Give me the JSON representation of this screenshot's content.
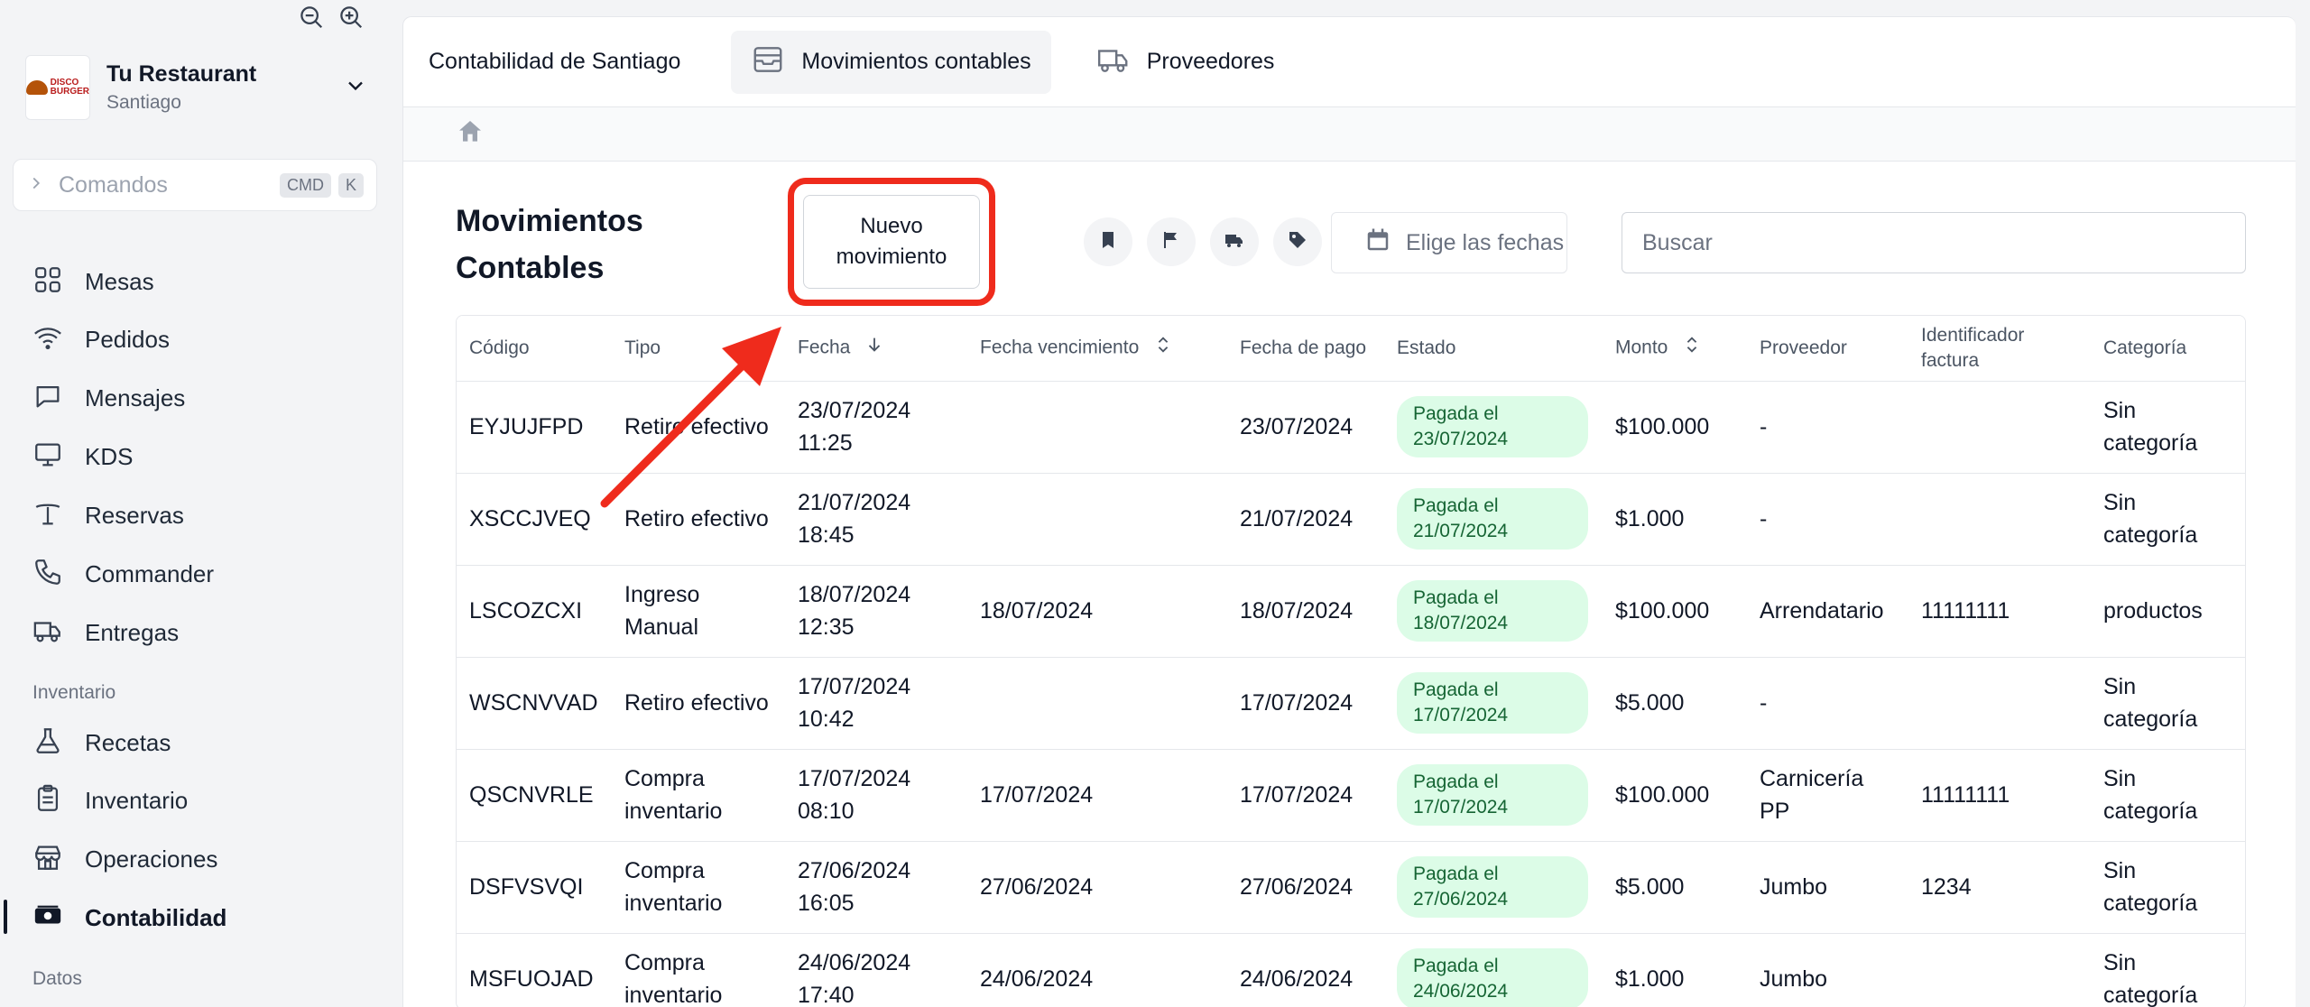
{
  "sidebar": {
    "restaurant_name": "Tu Restaurant",
    "restaurant_location": "Santiago",
    "logo_text_1": "DISCO",
    "logo_text_2": "BURGER",
    "command_label": "Comandos",
    "command_key_1": "CMD",
    "command_key_2": "K",
    "nav": [
      {
        "label": "Mesas",
        "icon": "grid-icon"
      },
      {
        "label": "Pedidos",
        "icon": "wifi-icon"
      },
      {
        "label": "Mensajes",
        "icon": "message-icon"
      },
      {
        "label": "KDS",
        "icon": "monitor-icon"
      },
      {
        "label": "Reservas",
        "icon": "table-icon"
      },
      {
        "label": "Commander",
        "icon": "phone-icon"
      },
      {
        "label": "Entregas",
        "icon": "truck-icon"
      }
    ],
    "section_inventario": "Inventario",
    "nav2": [
      {
        "label": "Recetas",
        "icon": "flask-icon"
      },
      {
        "label": "Inventario",
        "icon": "clipboard-icon"
      },
      {
        "label": "Operaciones",
        "icon": "store-icon"
      },
      {
        "label": "Contabilidad",
        "icon": "cash-icon"
      }
    ],
    "section_datos": "Datos"
  },
  "topbar": {
    "title": "Contabilidad de Santiago",
    "tabs": [
      {
        "label": "Movimientos contables",
        "active": true
      },
      {
        "label": "Proveedores",
        "active": false
      }
    ]
  },
  "page": {
    "heading": "Movimientos Contables",
    "new_button": "Nuevo movimiento",
    "date_placeholder": "Elige las fechas",
    "search_placeholder": "Buscar"
  },
  "table": {
    "headers": [
      "Código",
      "Tipo",
      "Fecha",
      "Fecha vencimiento",
      "Fecha de pago",
      "Estado",
      "Monto",
      "Proveedor",
      "Identificador factura",
      "Categoría"
    ],
    "rows": [
      {
        "codigo": "EYJUJFPD",
        "tipo": "Retiro efectivo",
        "fecha": "23/07/2024 11:25",
        "vencimiento": "",
        "pago": "23/07/2024",
        "estado": "Pagada el 23/07/2024",
        "monto": "$100.000",
        "proveedor": "-",
        "factura": "",
        "categoria": "Sin categoría"
      },
      {
        "codigo": "XSCCJVEQ",
        "tipo": "Retiro efectivo",
        "fecha": "21/07/2024 18:45",
        "vencimiento": "",
        "pago": "21/07/2024",
        "estado": "Pagada el 21/07/2024",
        "monto": "$1.000",
        "proveedor": "-",
        "factura": "",
        "categoria": "Sin categoría"
      },
      {
        "codigo": "LSCOZCXI",
        "tipo": "Ingreso Manual",
        "fecha": "18/07/2024 12:35",
        "vencimiento": "18/07/2024",
        "pago": "18/07/2024",
        "estado": "Pagada el 18/07/2024",
        "monto": "$100.000",
        "proveedor": "Arrendatario",
        "factura": "11111111",
        "categoria": "productos"
      },
      {
        "codigo": "WSCNVVAD",
        "tipo": "Retiro efectivo",
        "fecha": "17/07/2024 10:42",
        "vencimiento": "",
        "pago": "17/07/2024",
        "estado": "Pagada el 17/07/2024",
        "monto": "$5.000",
        "proveedor": "-",
        "factura": "",
        "categoria": "Sin categoría"
      },
      {
        "codigo": "QSCNVRLE",
        "tipo": "Compra inventario",
        "fecha": "17/07/2024 08:10",
        "vencimiento": "17/07/2024",
        "pago": "17/07/2024",
        "estado": "Pagada el 17/07/2024",
        "monto": "$100.000",
        "proveedor": "Carnicería PP",
        "factura": "11111111",
        "categoria": "Sin categoría"
      },
      {
        "codigo": "DSFVSVQI",
        "tipo": "Compra inventario",
        "fecha": "27/06/2024 16:05",
        "vencimiento": "27/06/2024",
        "pago": "27/06/2024",
        "estado": "Pagada el 27/06/2024",
        "monto": "$5.000",
        "proveedor": "Jumbo",
        "factura": "1234",
        "categoria": "Sin categoría"
      },
      {
        "codigo": "MSFUOJAD",
        "tipo": "Compra inventario",
        "fecha": "24/06/2024 17:40",
        "vencimiento": "24/06/2024",
        "pago": "24/06/2024",
        "estado": "Pagada el 24/06/2024",
        "monto": "$1.000",
        "proveedor": "Jumbo",
        "factura": "",
        "categoria": "Sin categoría"
      }
    ]
  },
  "colors": {
    "highlight": "#ef2b1c",
    "badge_bg": "#dcfce7",
    "badge_text": "#166534"
  }
}
